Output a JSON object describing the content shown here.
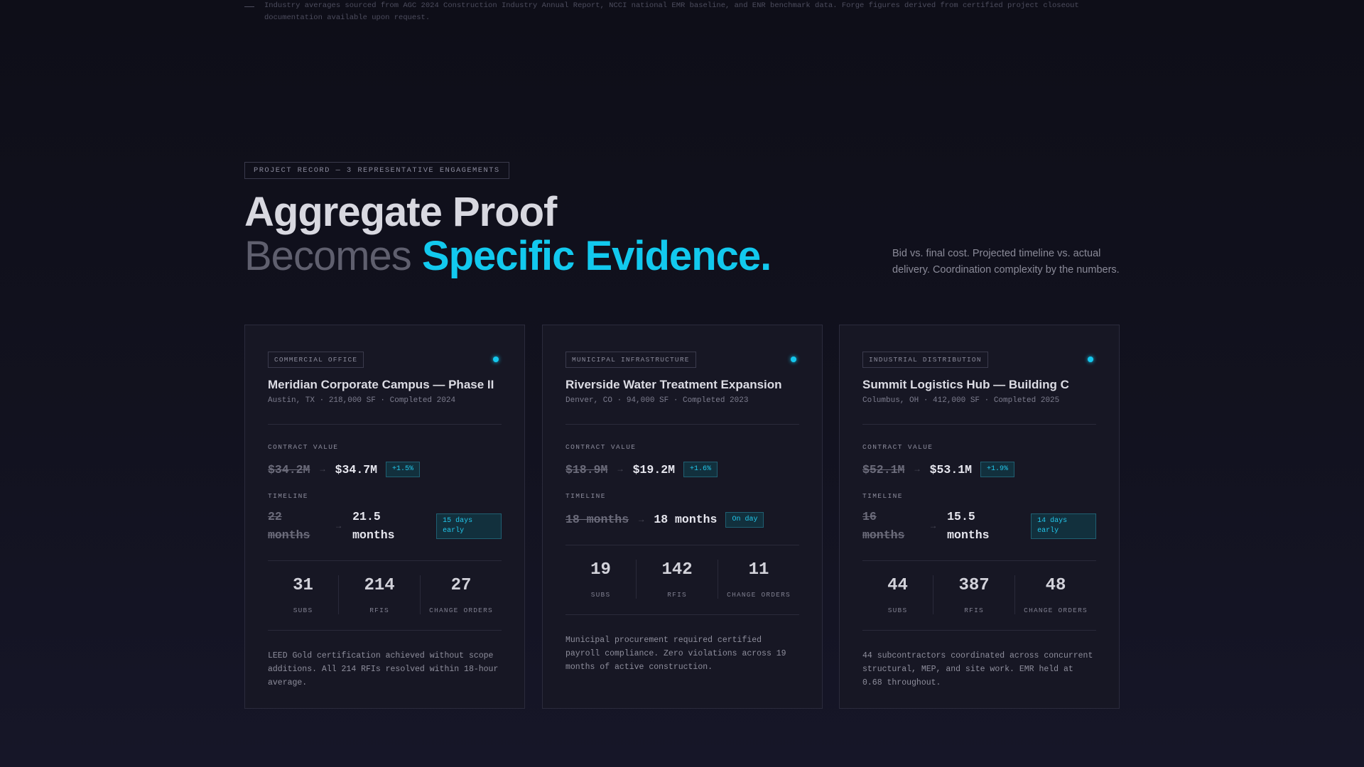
{
  "footnote": "Industry averages sourced from AGC 2024 Construction Industry Annual Report, NCCI national EMR baseline, and ENR benchmark data. Forge figures derived from certified project closeout documentation available upon request.",
  "header": {
    "eyebrow": "PROJECT RECORD — 3 REPRESENTATIVE ENGAGEMENTS",
    "headline_line1": "Aggregate Proof",
    "headline_line2_muted": "Becomes",
    "headline_line2_accent": "Specific Evidence.",
    "lede": "Bid vs. final cost. Projected timeline vs. actual delivery. Coordination complexity by the numbers."
  },
  "labels": {
    "contract_value": "CONTRACT VALUE",
    "timeline": "TIMELINE",
    "arrow": "→",
    "subs": "SUBS",
    "rfis": "RFIS",
    "change_orders": "CHANGE ORDERS"
  },
  "colors": {
    "accent": "#12c9ee",
    "background": "#0e0e18",
    "card": "#171724"
  },
  "projects": [
    {
      "tag": "COMMERCIAL OFFICE",
      "title": "Meridian Corporate Campus — Phase II",
      "meta": "Austin, TX · 218,000 SF · Completed 2024",
      "bid": "$34.2M",
      "final": "$34.7M",
      "cost_delta": "+1.5%",
      "timeline_projected": "22 months",
      "timeline_actual": "21.5 months",
      "timeline_delta": "15 days early",
      "subs": "31",
      "rfis": "214",
      "change_orders": "27",
      "note": "LEED Gold certification achieved without scope additions. All 214 RFIs resolved within 18-hour average."
    },
    {
      "tag": "MUNICIPAL INFRASTRUCTURE",
      "title": "Riverside Water Treatment Expansion",
      "meta": "Denver, CO · 94,000 SF · Completed 2023",
      "bid": "$18.9M",
      "final": "$19.2M",
      "cost_delta": "+1.6%",
      "timeline_projected": "18 months",
      "timeline_actual": "18 months",
      "timeline_delta": "On day",
      "subs": "19",
      "rfis": "142",
      "change_orders": "11",
      "note": "Municipal procurement required certified payroll compliance. Zero violations across 19 months of active construction."
    },
    {
      "tag": "INDUSTRIAL DISTRIBUTION",
      "title": "Summit Logistics Hub — Building C",
      "meta": "Columbus, OH · 412,000 SF · Completed 2025",
      "bid": "$52.1M",
      "final": "$53.1M",
      "cost_delta": "+1.9%",
      "timeline_projected": "16 months",
      "timeline_actual": "15.5 months",
      "timeline_delta": "14 days early",
      "subs": "44",
      "rfis": "387",
      "change_orders": "48",
      "note": "44 subcontractors coordinated across concurrent structural, MEP, and site work. EMR held at 0.68 throughout."
    }
  ]
}
